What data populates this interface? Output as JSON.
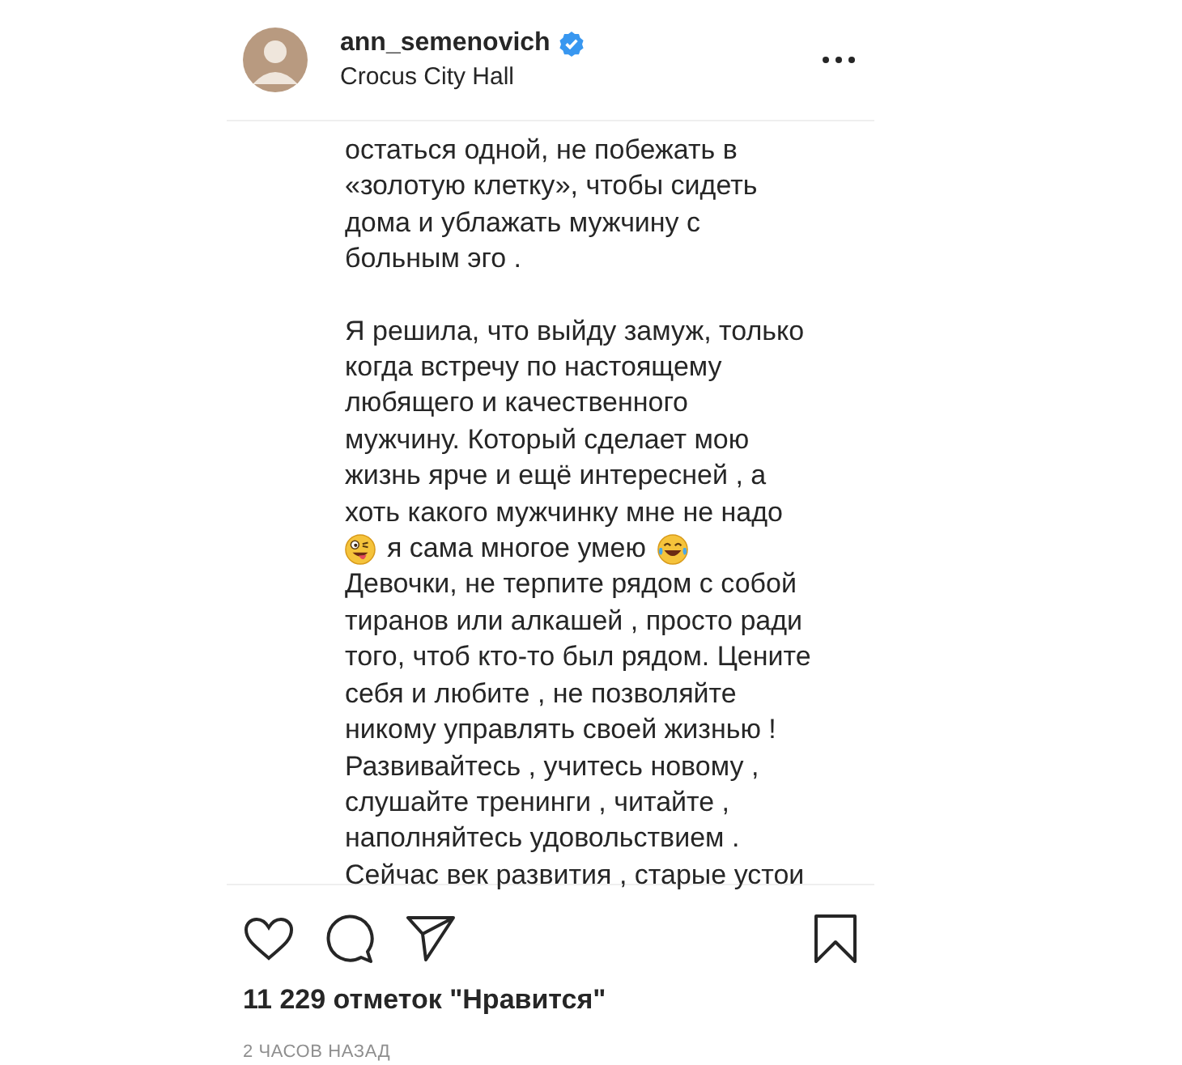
{
  "header": {
    "username": "ann_semenovich",
    "verified": true,
    "location": "Crocus City Hall"
  },
  "caption": {
    "paragraphs": [
      {
        "lines": [
          {
            "kind": "text",
            "text": "остаться одной, не побежать в"
          },
          {
            "kind": "text",
            "text": "«золотую клетку», чтобы сидеть"
          },
          {
            "kind": "text",
            "text": "дома и ублажать мужчину с"
          },
          {
            "kind": "text",
            "text": "больным эго ."
          }
        ]
      },
      {
        "lines": [
          {
            "kind": "text",
            "text": "Я решила, что выйду замуж, только"
          },
          {
            "kind": "text",
            "text": "когда встречу по настоящему"
          },
          {
            "kind": "text",
            "text": "любящего и качественного"
          },
          {
            "kind": "text",
            "text": "мужчину. Который сделает мою"
          },
          {
            "kind": "text",
            "text": "жизнь ярче и ещё интересней , а"
          },
          {
            "kind": "text",
            "text": "хоть какого мужчинку мне не надо"
          },
          {
            "kind": "emoji",
            "text": "я сама многое умею"
          },
          {
            "kind": "text",
            "text": "Девочки, не терпите рядом с собой"
          },
          {
            "kind": "text",
            "text": "тиранов или алкашей , просто ради"
          },
          {
            "kind": "text",
            "text": "того, чтоб кто-то был рядом. Цените"
          },
          {
            "kind": "text",
            "text": "себя и любите , не позволяйте"
          },
          {
            "kind": "text",
            "text": "никому управлять своей жизнью !"
          },
          {
            "kind": "text",
            "text": "Развивайтесь , учитесь новому ,"
          },
          {
            "kind": "text",
            "text": "слушайте тренинги , читайте ,"
          },
          {
            "kind": "text",
            "text": "наполняйтесь удовольствием ."
          },
          {
            "kind": "text",
            "text": "Сейчас век развития , старые устои"
          }
        ]
      }
    ]
  },
  "likes": "11 229 отметок \"Нравится\"",
  "time": "2 ЧАСОВ НАЗАД"
}
